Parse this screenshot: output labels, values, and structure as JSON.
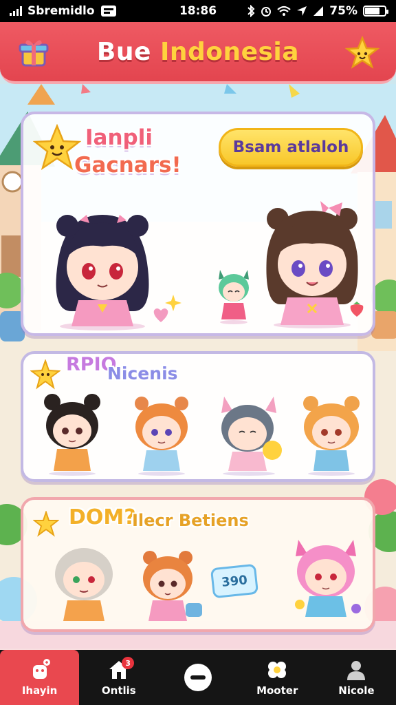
{
  "status_bar": {
    "carrier": "Sbremidlo",
    "time": "18:86",
    "battery": "75%",
    "battery_level": 0.75
  },
  "header": {
    "title_part1": "Bue ",
    "title_part2": "Indonesia"
  },
  "featured": {
    "title_line1": "Ianpli",
    "title_line2": "Gacnars!",
    "cta_label": "Bsam atlaloh"
  },
  "new_section": {
    "label_1": "RPIO",
    "label_2": "Nicenis"
  },
  "more_section": {
    "label_1": "DOM?",
    "label_2": "Ilecr Betiens",
    "price_tag": "390"
  },
  "bottom_nav": {
    "items": [
      {
        "label": "Ihayin",
        "icon": "character-icon",
        "active": true
      },
      {
        "label": "Ontlis",
        "icon": "home-icon",
        "badge": "3"
      },
      {
        "label": "",
        "icon": "minus-icon"
      },
      {
        "label": "Mooter",
        "icon": "flower-icon"
      },
      {
        "label": "Nicole",
        "icon": "profile-icon"
      }
    ]
  },
  "colors": {
    "header_red": "#e3454f",
    "accent_yellow": "#ffd23e",
    "panel_border_purple": "#c7b8e6",
    "nav_bg": "#151515"
  }
}
